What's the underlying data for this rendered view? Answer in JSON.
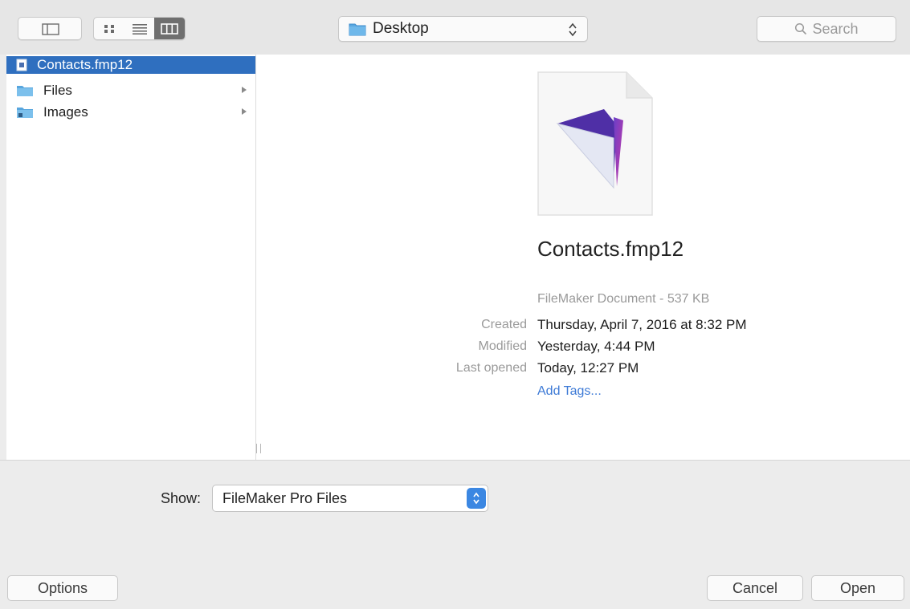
{
  "toolbar": {
    "location": "Desktop",
    "search_placeholder": "Search"
  },
  "sidebar_column": {
    "items": [
      {
        "label": "Contacts.fmp12",
        "icon": "document-icon",
        "selected": true,
        "has_children": false
      },
      {
        "label": "Files",
        "icon": "folder-icon",
        "selected": false,
        "has_children": true
      },
      {
        "label": "Images",
        "icon": "folder-icon",
        "selected": false,
        "has_children": true
      }
    ]
  },
  "preview": {
    "file_name": "Contacts.fmp12",
    "kind_size": "FileMaker Document - 537 KB",
    "created_label": "Created",
    "created_value": "Thursday, April 7, 2016 at 8:32 PM",
    "modified_label": "Modified",
    "modified_value": "Yesterday, 4:44 PM",
    "opened_label": "Last opened",
    "opened_value": "Today, 12:27 PM",
    "add_tags": "Add Tags..."
  },
  "filter": {
    "label": "Show:",
    "selected": "FileMaker Pro Files"
  },
  "buttons": {
    "options": "Options",
    "cancel": "Cancel",
    "open": "Open"
  },
  "colors": {
    "selection": "#2f6fbf",
    "link": "#3d7ad6",
    "stepper": "#3b87e2"
  }
}
